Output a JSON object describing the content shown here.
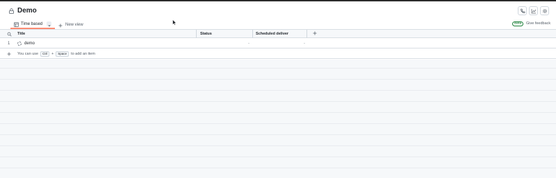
{
  "header": {
    "title": "Demo",
    "icons": [
      "lock-icon",
      "phone-icon",
      "chart-icon",
      "gear-icon"
    ]
  },
  "views": {
    "active_tab": "Time based",
    "new_view_label": "New view"
  },
  "feedback": {
    "beta_label": "Beta",
    "link_label": "Give feedback"
  },
  "table": {
    "columns": [
      "Title",
      "Status",
      "Scheduled deliver"
    ],
    "rows": [
      {
        "number": "1",
        "title": "demo",
        "status": "-",
        "scheduled": "-"
      }
    ],
    "add_hint": {
      "prefix": "You can use",
      "key1": "Ctrl",
      "plus": "+",
      "key2": "Space",
      "suffix": "to add an item"
    }
  },
  "colors": {
    "accent": "#fd8c73",
    "beta": "#1a7f37",
    "border": "#d8dee4"
  }
}
